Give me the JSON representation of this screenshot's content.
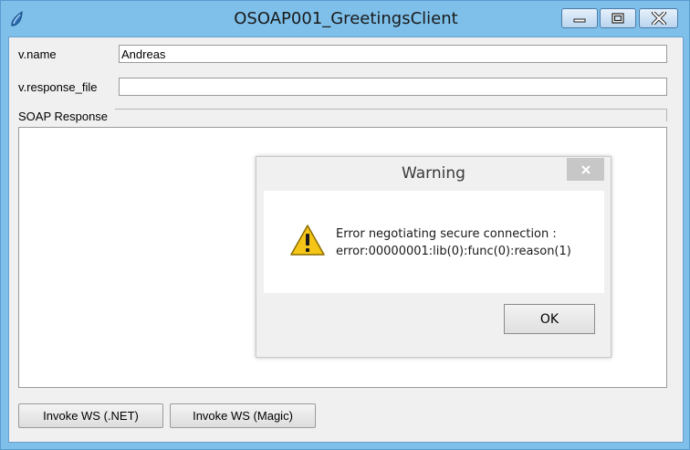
{
  "window": {
    "title": "OSOAP001_GreetingsClient",
    "controls": [
      "minimize-icon",
      "maximize-icon",
      "close-icon"
    ]
  },
  "form": {
    "name_label": "v.name",
    "name_value": "Andreas",
    "response_file_label": "v.response_file",
    "response_file_value": "",
    "soap_response_label": "SOAP Response"
  },
  "buttons": {
    "invoke_net": "Invoke WS (.NET)",
    "invoke_magic": "Invoke WS (Magic)"
  },
  "dialog": {
    "title": "Warning",
    "message_line1": "Error negotiating secure connection :",
    "message_line2": "error:00000001:lib(0):func(0):reason(1)",
    "ok_label": "OK",
    "icon": "warning-icon"
  },
  "colors": {
    "window_frame": "#7ec0ea",
    "client_bg": "#f0f0f0",
    "warning_yellow": "#f5c518"
  }
}
